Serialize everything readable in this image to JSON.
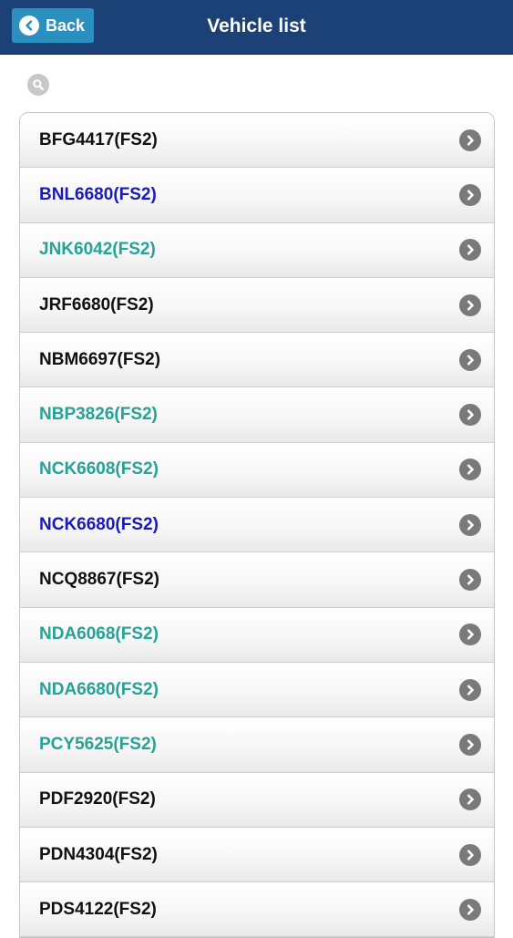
{
  "header": {
    "title": "Vehicle list",
    "back_label": "Back",
    "bar_color": "#1c4176",
    "back_button_color": "#2b8fbf"
  },
  "search": {
    "placeholder": "",
    "value": ""
  },
  "vehicles": [
    {
      "label": "BFG4417(FS2)",
      "color": "#111111"
    },
    {
      "label": "BNL6680(FS2)",
      "color": "#1a1ab8"
    },
    {
      "label": "JNK6042(FS2)",
      "color": "#27a296"
    },
    {
      "label": "JRF6680(FS2)",
      "color": "#111111"
    },
    {
      "label": "NBM6697(FS2)",
      "color": "#111111"
    },
    {
      "label": "NBP3826(FS2)",
      "color": "#27a296"
    },
    {
      "label": "NCK6608(FS2)",
      "color": "#27a296"
    },
    {
      "label": "NCK6680(FS2)",
      "color": "#1a1ab8"
    },
    {
      "label": "NCQ8867(FS2)",
      "color": "#111111"
    },
    {
      "label": "NDA6068(FS2)",
      "color": "#27a296"
    },
    {
      "label": "NDA6680(FS2)",
      "color": "#27a296"
    },
    {
      "label": "PCY5625(FS2)",
      "color": "#27a296"
    },
    {
      "label": "PDF2920(FS2)",
      "color": "#111111"
    },
    {
      "label": "PDN4304(FS2)",
      "color": "#111111"
    },
    {
      "label": "PDS4122(FS2)",
      "color": "#111111"
    }
  ],
  "icons": {
    "back": "chevron-left-icon",
    "search": "search-icon",
    "row": "chevron-right-icon"
  }
}
